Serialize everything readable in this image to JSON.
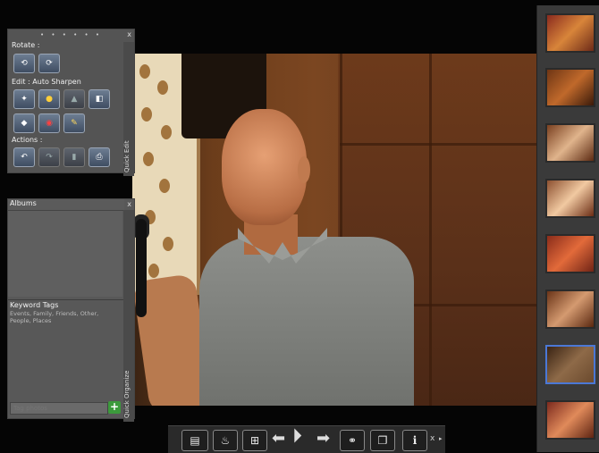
{
  "quick_edit": {
    "rotate_label": "Rotate :",
    "edit_label": "Edit : Auto Sharpen",
    "actions_label": "Actions :",
    "tab_label": "Quick Edit",
    "close": "x"
  },
  "organize": {
    "albums_label": "Albums",
    "keyword_tags_label": "Keyword Tags",
    "keyword_tags_list": "Events, Family, Friends, Other, People, Places",
    "tag_placeholder": "Tag photos",
    "tab_label": "Quick Organize",
    "close": "x"
  },
  "toolbar": {
    "info_label": "i",
    "close": "x"
  },
  "filmstrip": {
    "selected_index": 6,
    "count": 8
  },
  "colors": {
    "selection_border": "#4b78d6",
    "add_button": "#3c9a3c"
  }
}
